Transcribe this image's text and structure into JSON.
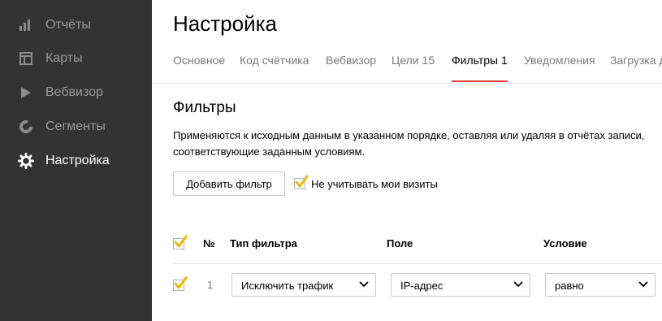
{
  "sidebar": {
    "items": [
      {
        "label": "Отчёты",
        "icon": "bar-chart-icon"
      },
      {
        "label": "Карты",
        "icon": "map-grid-icon"
      },
      {
        "label": "Вебвизор",
        "icon": "play-icon"
      },
      {
        "label": "Сегменты",
        "icon": "segments-ring-icon"
      },
      {
        "label": "Настройка",
        "icon": "gear-icon"
      }
    ],
    "active": "Настройка"
  },
  "page": {
    "title": "Настройка"
  },
  "tabs": [
    {
      "label": "Основное"
    },
    {
      "label": "Код счётчика"
    },
    {
      "label": "Вебвизор"
    },
    {
      "label": "Цели 15"
    },
    {
      "label": "Фильтры 1"
    },
    {
      "label": "Уведомления"
    },
    {
      "label": "Загрузка д"
    }
  ],
  "active_tab": "Фильтры 1",
  "filters": {
    "title": "Фильтры",
    "description": "Применяются к исходным данным в указанном порядке, оставляя или удаляя в отчётах записи, соответствующие заданным условиям.",
    "add_button": "Добавить фильтр",
    "ignore_visits_label": "Не учитывать мои визиты",
    "ignore_visits_checked": true,
    "table": {
      "headers": {
        "num": "№",
        "type": "Тип фильтра",
        "field": "Поле",
        "condition": "Условие"
      },
      "select_all_checked": true,
      "rows": [
        {
          "checked": true,
          "num": "1",
          "type": "Исключить трафик",
          "field": "IP-адрес",
          "condition": "равно"
        }
      ]
    }
  },
  "colors": {
    "sidebar_bg": "#333333",
    "sidebar_text": "#9a9a9a",
    "sidebar_active_text": "#ffffff",
    "tab_underline": "#e53935",
    "checkmark": "#f2b705"
  }
}
